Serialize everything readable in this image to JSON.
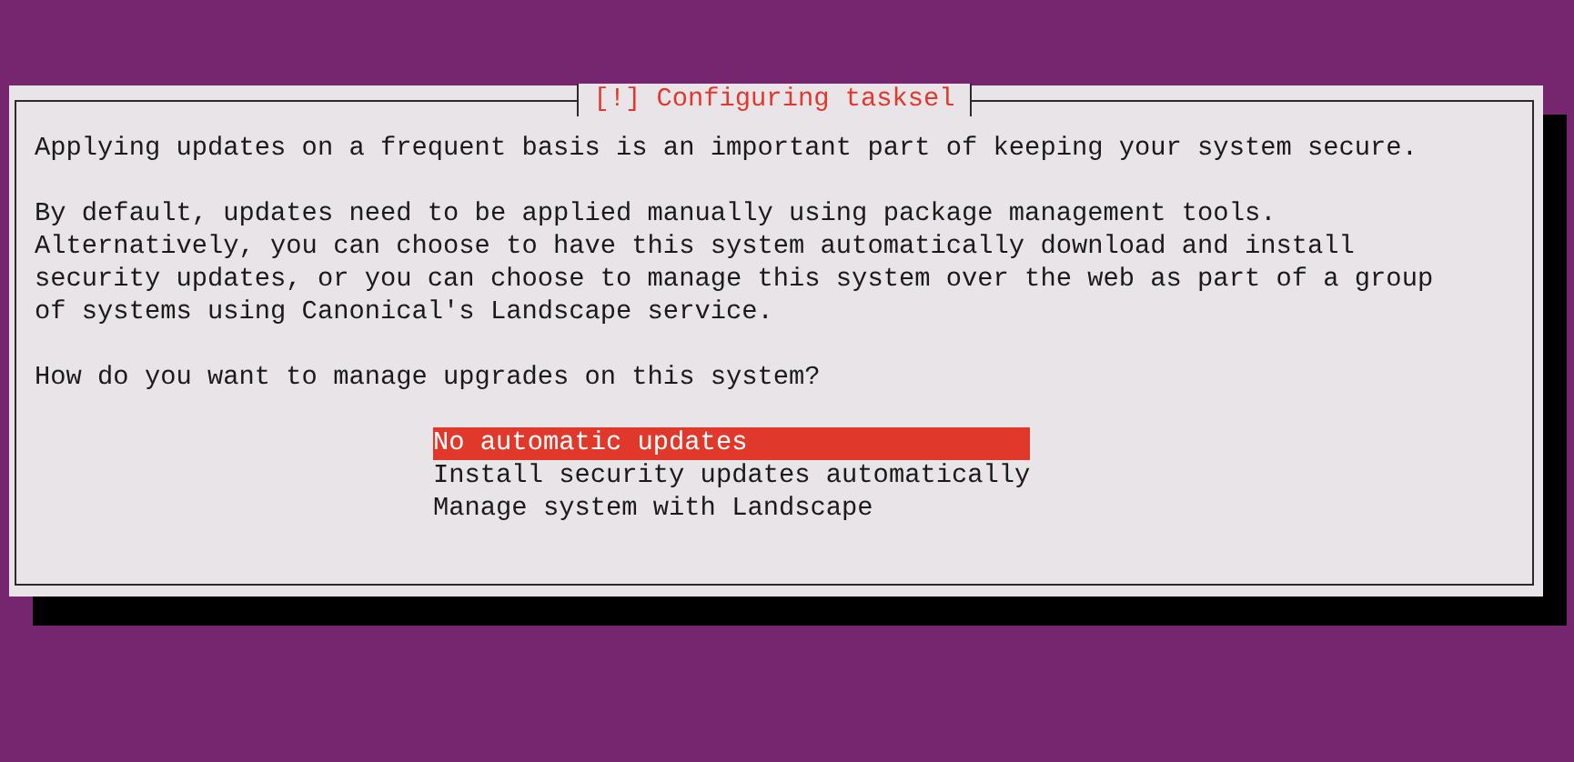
{
  "dialog": {
    "title": "[!] Configuring tasksel",
    "paragraphs": [
      "Applying updates on a frequent basis is an important part of keeping your system secure.",
      "By default, updates need to be applied manually using package management tools.\nAlternatively, you can choose to have this system automatically download and install\nsecurity updates, or you can choose to manage this system over the web as part of a group\nof systems using Canonical's Landscape service."
    ],
    "question": "How do you want to manage upgrades on this system?",
    "options": [
      {
        "label": "No automatic updates",
        "selected": true
      },
      {
        "label": "Install security updates automatically",
        "selected": false
      },
      {
        "label": "Manage system with Landscape",
        "selected": false
      }
    ]
  }
}
